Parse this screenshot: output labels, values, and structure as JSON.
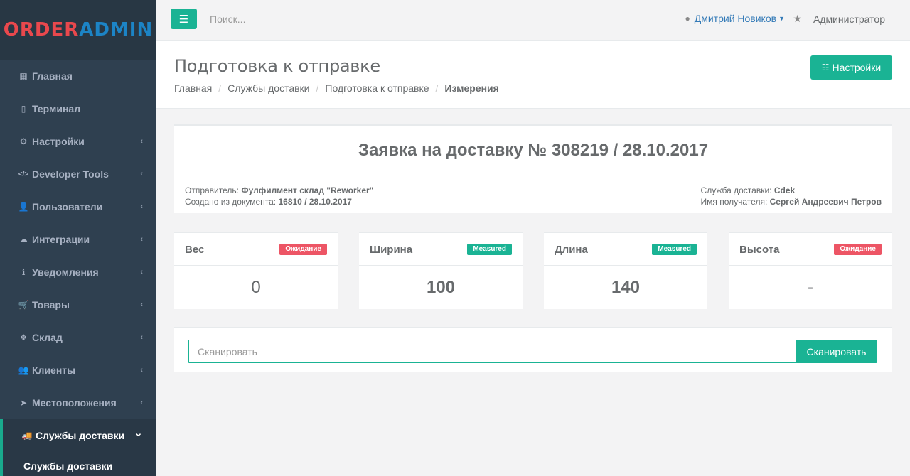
{
  "brand": {
    "part1": "ORDER",
    "part2": "ADMIN"
  },
  "sidebar": {
    "items": [
      {
        "label": "Главная",
        "icon": "grid-icon",
        "glyph": "▦",
        "chevron": false
      },
      {
        "label": "Терминал",
        "icon": "mobile-icon",
        "glyph": "▯",
        "chevron": false
      },
      {
        "label": "Настройки",
        "icon": "gear-icon",
        "glyph": "⚙",
        "chevron": true
      },
      {
        "label": "Developer Tools",
        "icon": "code-icon",
        "glyph": "</>",
        "chevron": true
      },
      {
        "label": "Пользователи",
        "icon": "user-icon",
        "glyph": "👤",
        "chevron": true
      },
      {
        "label": "Интеграции",
        "icon": "cloud-download-icon",
        "glyph": "☁",
        "chevron": true
      },
      {
        "label": "Уведомления",
        "icon": "info-icon",
        "glyph": "ℹ",
        "chevron": true
      },
      {
        "label": "Товары",
        "icon": "cart-icon",
        "glyph": "🛒",
        "chevron": true
      },
      {
        "label": "Склад",
        "icon": "cubes-icon",
        "glyph": "❖",
        "chevron": true
      },
      {
        "label": "Клиенты",
        "icon": "users-icon",
        "glyph": "👥",
        "chevron": true
      },
      {
        "label": "Местоположения",
        "icon": "location-arrow-icon",
        "glyph": "➤",
        "chevron": true
      },
      {
        "label": "Службы доставки",
        "icon": "truck-icon",
        "glyph": "🚚",
        "chevron": true,
        "active": true
      }
    ],
    "subitem": "Службы доставки"
  },
  "topbar": {
    "search_placeholder": "Поиск...",
    "user_name": "Дмитрий Новиков",
    "role": "Администратор"
  },
  "page": {
    "title": "Подготовка к отправке",
    "breadcrumb": [
      "Главная",
      "Службы доставки",
      "Подготовка к отправке",
      "Измерения"
    ],
    "settings_label": "Настройки"
  },
  "request": {
    "title": "Заявка на доставку № 308219 / 28.10.2017",
    "sender_label": "Отправитель:",
    "sender_value": "Фулфилмент склад \"Reworker\"",
    "created_label": "Создано из документа:",
    "created_value": "16810 / 28.10.2017",
    "service_label": "Служба доставки:",
    "service_value": "Cdek",
    "recipient_label": "Имя получателя:",
    "recipient_value": "Сергей Андреевич Петров"
  },
  "measures": [
    {
      "label": "Вес",
      "status": "Ожидание",
      "status_type": "wait",
      "value": "0",
      "bold": false
    },
    {
      "label": "Ширина",
      "status": "Measured",
      "status_type": "meas",
      "value": "100",
      "bold": true
    },
    {
      "label": "Длина",
      "status": "Measured",
      "status_type": "meas",
      "value": "140",
      "bold": true
    },
    {
      "label": "Высота",
      "status": "Ожидание",
      "status_type": "wait",
      "value": "-",
      "bold": false
    }
  ],
  "scan": {
    "placeholder": "Сканировать",
    "button_label": "Сканировать"
  },
  "colors": {
    "accent": "#1ab394",
    "danger": "#ed5565",
    "sidebar": "#2f4050",
    "link": "#337ab7"
  }
}
